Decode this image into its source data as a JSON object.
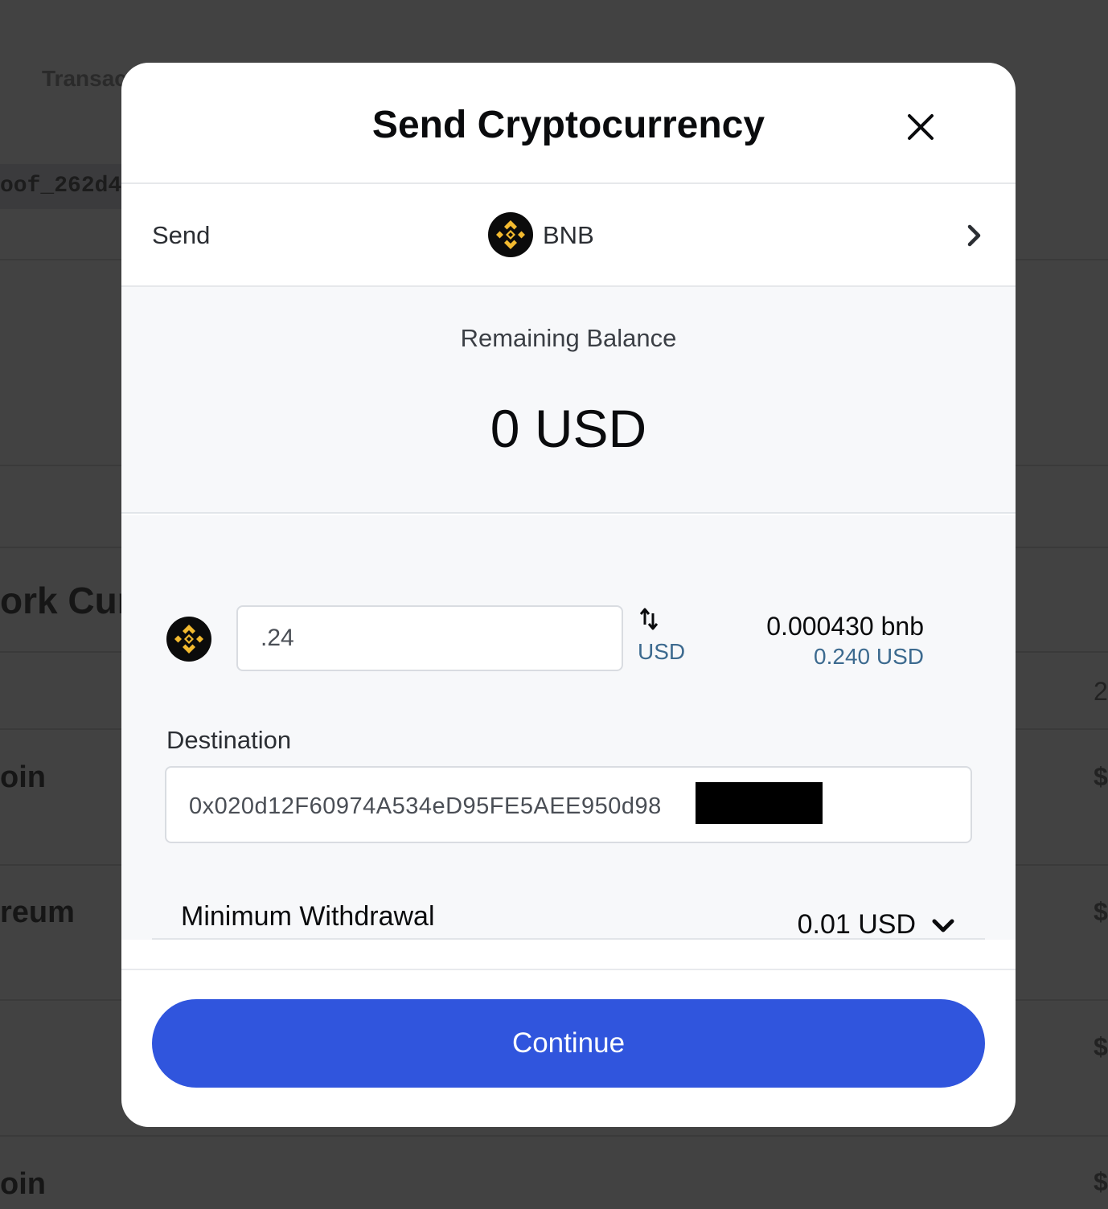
{
  "background": {
    "transactions_fragment": "Transac",
    "proof_fragment": "oof_262d4",
    "section_fragment": "ork Cur",
    "row_1_fragment": "oin",
    "row_2_fragment": "reum",
    "row_3_fragment": "oin",
    "right_digit": "2",
    "right_symbols": [
      "$",
      "$",
      "$",
      "$"
    ]
  },
  "modal": {
    "title": "Send Cryptocurrency",
    "send_row": {
      "label": "Send",
      "asset": "BNB",
      "asset_icon": "bnb-logo-icon"
    },
    "balance": {
      "label": "Remaining Balance",
      "value": "0 USD"
    },
    "amount": {
      "value": ".24",
      "unit_toggle_label": "USD",
      "converted_crypto": "0.000430 bnb",
      "converted_fiat": "0.240 USD"
    },
    "destination": {
      "label": "Destination",
      "address_visible": "0x020d12F60974A534eD95FE5AEE950d98"
    },
    "minimum_withdrawal": {
      "label": "Minimum Withdrawal",
      "value": "0.01 USD"
    },
    "continue_label": "Continue"
  },
  "colors": {
    "accent": "#3055dd",
    "bnb_yellow": "#F3BA2F",
    "link_blue": "#3c6a8f"
  }
}
